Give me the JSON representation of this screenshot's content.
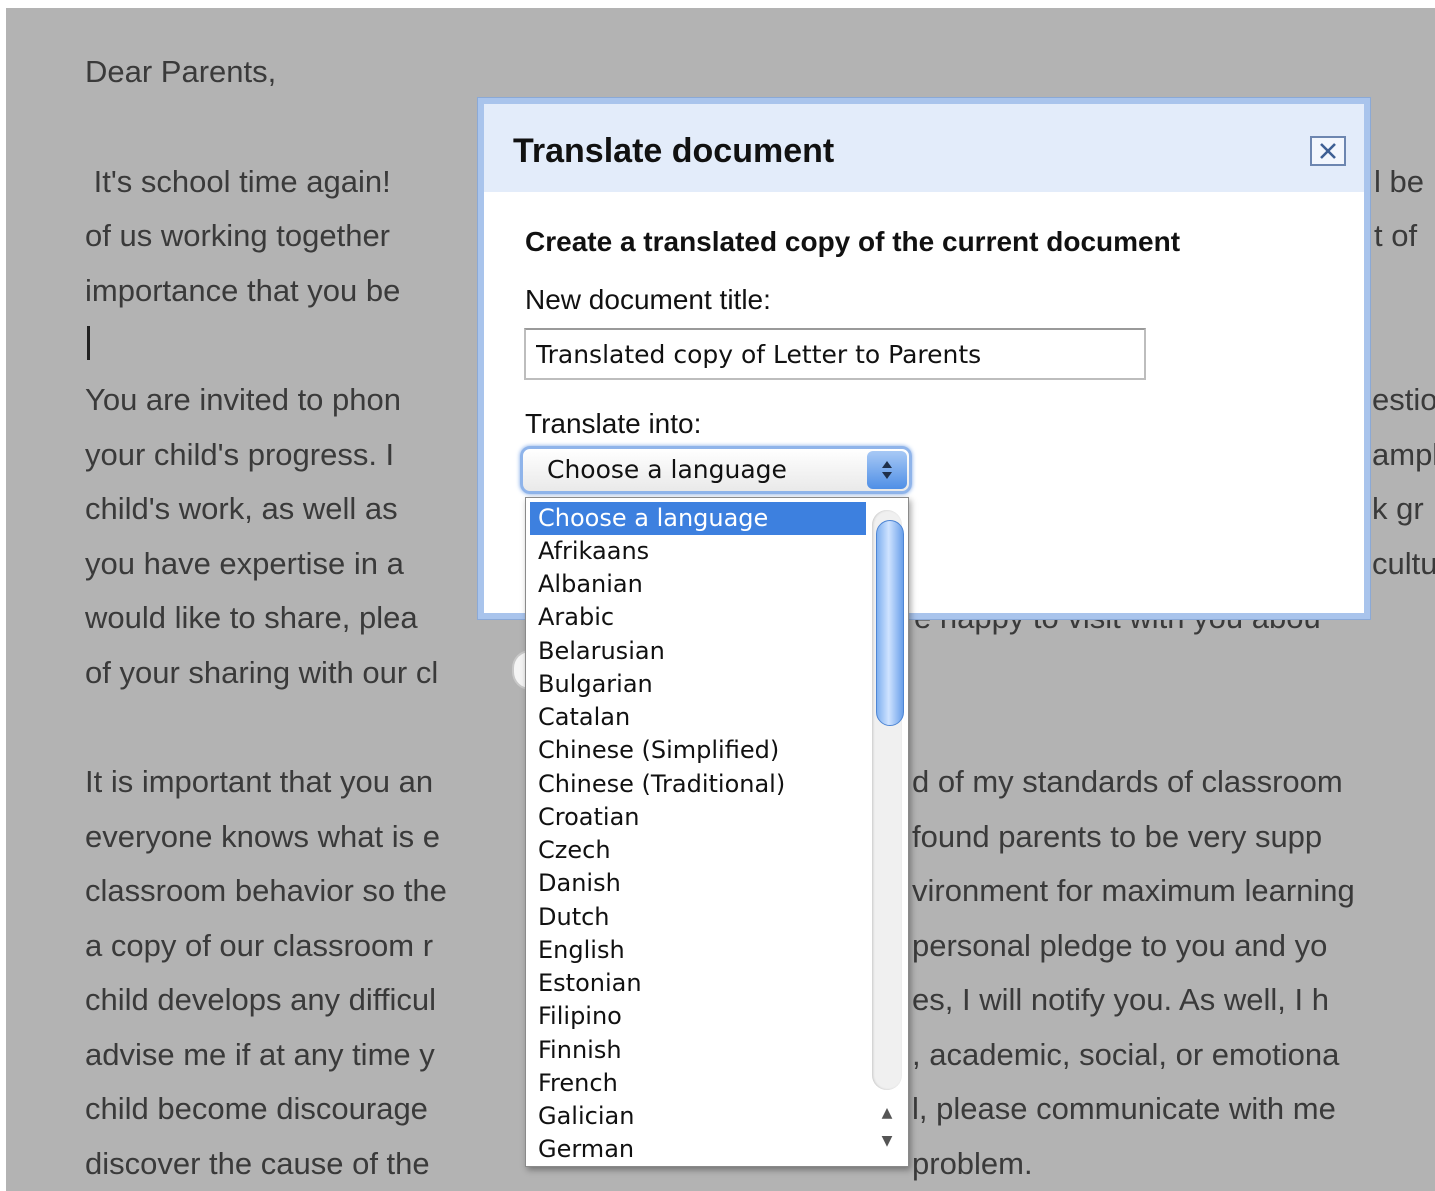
{
  "document": {
    "lines": [
      "Dear Parents,",
      " It's school time again!",
      "of us working together",
      "importance that you be",
      "You are invited to phon",
      "your child's progress. I",
      "child's work, as well as",
      "you have expertise in a",
      "would like to share, plea",
      "of your sharing with our cl",
      "It is important that you an",
      "everyone knows what is e",
      "classroom behavior so the",
      "a copy of our classroom r",
      "child develops any difficul",
      "advise me if at any time y",
      "child become discourage",
      "discover the cause of the"
    ],
    "right_fragments": [
      "l be",
      "t of",
      "estio",
      "ampl",
      "k gr",
      "cultu",
      "e happy to visit with you abou",
      "d of my standards of classroom",
      "found parents to be very supp",
      "vironment for maximum learning",
      "personal pledge to you and yo",
      "es, I will notify you. As well, I h",
      ", academic, social, or emotiona",
      "l, please communicate with me",
      "problem."
    ]
  },
  "dialog": {
    "title": "Translate document",
    "close_icon": "close-icon",
    "subtitle": "Create a translated copy of the current document",
    "new_title_label": "New document title:",
    "new_title_value": "Translated copy of Letter to Parents",
    "translate_into_label": "Translate into:",
    "language_select_value": "Choose a language"
  },
  "language_list": {
    "selected_index": 0,
    "options": [
      "Choose a language",
      "Afrikaans",
      "Albanian",
      "Arabic",
      "Belarusian",
      "Bulgarian",
      "Catalan",
      "Chinese (Simplified)",
      "Chinese (Traditional)",
      "Croatian",
      "Czech",
      "Danish",
      "Dutch",
      "English",
      "Estonian",
      "Filipino",
      "Finnish",
      "French",
      "Galician",
      "German"
    ],
    "scroll_up_glyph": "▲",
    "scroll_down_glyph": "▼"
  },
  "colors": {
    "backdrop": "#b3b3b3",
    "dialog_frame": "#a9c4ec",
    "dialog_header": "#e3ecfa",
    "selection": "#3d80df"
  }
}
